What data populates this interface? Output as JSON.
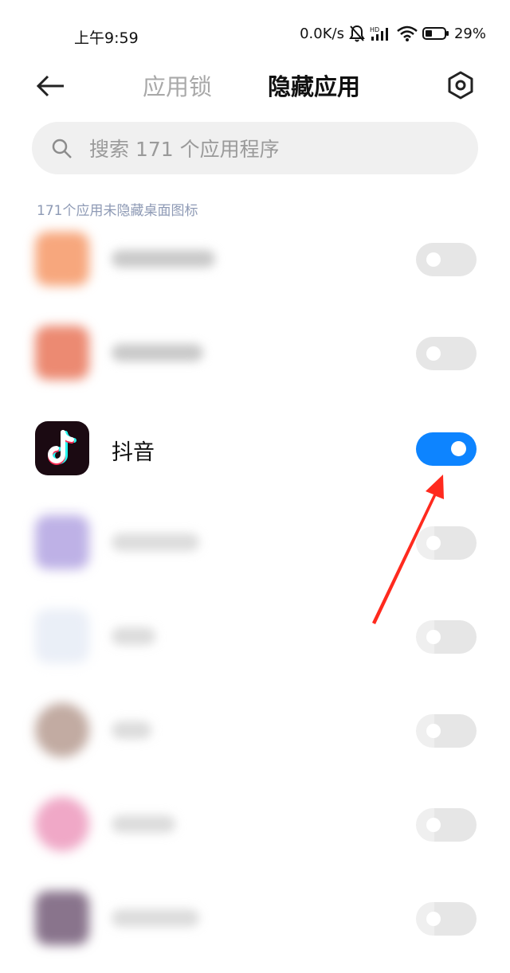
{
  "status_bar": {
    "time": "上午9:59",
    "speed": "0.0K/s",
    "battery": "29%"
  },
  "header": {
    "tab_lock": "应用锁",
    "tab_hide": "隐藏应用"
  },
  "search": {
    "placeholder": "搜索 171 个应用程序"
  },
  "section_label": "171个应用未隐藏桌面图标",
  "apps": [
    {
      "name": "",
      "hidden": false,
      "icon_color": "#f7a77d"
    },
    {
      "name": "",
      "hidden": false,
      "icon_color": "#ec8a72"
    },
    {
      "name": "抖音",
      "hidden": true,
      "icon_color": "#1b0a12"
    },
    {
      "name": "",
      "hidden": false,
      "icon_color": "#9b88d9"
    },
    {
      "name": "",
      "hidden": false,
      "icon_color": "#dfe6f3"
    },
    {
      "name": "",
      "hidden": false,
      "icon_color": "#a17e70"
    },
    {
      "name": "",
      "hidden": false,
      "icon_color": "#e87aa9"
    },
    {
      "name": "",
      "hidden": false,
      "icon_color": "#4a2a4f"
    }
  ],
  "colors": {
    "accent": "#0d84ff",
    "annotation_arrow": "#ff2a1e"
  }
}
